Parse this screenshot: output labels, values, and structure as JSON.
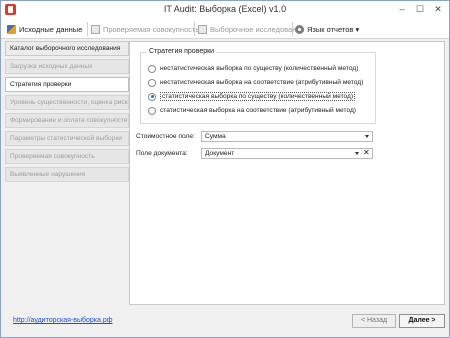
{
  "window": {
    "title": "IT Audit: Выборка (Excel) v1.0",
    "minimize": "–",
    "maximize": "☐",
    "close": "✕"
  },
  "toolbar": {
    "source_data": "Исходные данные",
    "checked_population": "Проверяемая совокупность",
    "sampling_study": "Выборочное исследование",
    "report_language": "Язык отчетов ▾"
  },
  "sidebar": {
    "items": [
      {
        "label": "Каталог выборочного исследования"
      },
      {
        "label": "Загрузка исходных данных"
      },
      {
        "label": "Стратегия проверки"
      },
      {
        "label": "Уровень существенности, оценка риска"
      },
      {
        "label": "Формирование и оплата совокупностей"
      },
      {
        "label": "Параметры статистической выборки"
      },
      {
        "label": "Проверяемая совокупность"
      },
      {
        "label": "Выявленные нарушения"
      }
    ]
  },
  "strategy": {
    "title": "Стратегия проверки",
    "options": [
      {
        "label": "нестатистическая выборка по существу (количественный метод)",
        "selected": false
      },
      {
        "label": "нестатистическая выборка на соответствие (атрибутивный метод)",
        "selected": false
      },
      {
        "label": "статистическая выборка по существу (количественный метод)",
        "selected": true
      },
      {
        "label": "статистическая выборка на соответствие (атрибутивный метод)",
        "selected": false
      }
    ]
  },
  "fields": {
    "value_label": "Стоимостное поле:",
    "value": "Сумма",
    "document_label": "Поле документа:",
    "document": "Документ",
    "clear": "✕"
  },
  "footer": {
    "link": "http://аудиторская-выборка.рф",
    "back": "< Назад",
    "next": "Далее >"
  },
  "colors": {
    "accent": "#2b6fc8",
    "link": "#1a4fd6"
  }
}
